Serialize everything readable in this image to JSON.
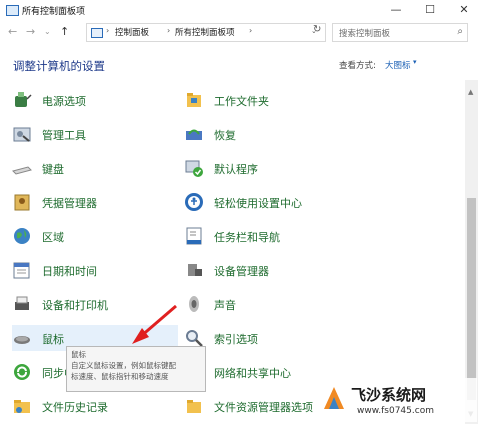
{
  "window": {
    "title": "所有控制面板项",
    "minimize": "—",
    "maximize": "☐",
    "close": "✕"
  },
  "address": {
    "crumbs": [
      "控制面板",
      "所有控制面板项"
    ],
    "refresh": "↻",
    "search_placeholder": "搜索控制面板"
  },
  "header": {
    "title": "调整计算机的设置",
    "view_by_label": "查看方式:",
    "view_by_value": "大图标",
    "caret": "▾"
  },
  "items_left": [
    {
      "label": "电源选项",
      "icon": "power-icon"
    },
    {
      "label": "管理工具",
      "icon": "admin-tools-icon"
    },
    {
      "label": "键盘",
      "icon": "keyboard-icon"
    },
    {
      "label": "凭据管理器",
      "icon": "credential-icon"
    },
    {
      "label": "区域",
      "icon": "globe-icon"
    },
    {
      "label": "日期和时间",
      "icon": "calendar-icon"
    },
    {
      "label": "设备和打印机",
      "icon": "printer-icon"
    },
    {
      "label": "鼠标",
      "icon": "mouse-icon"
    },
    {
      "label": "同步中心",
      "icon": "sync-icon"
    },
    {
      "label": "文件历史记录",
      "icon": "file-history-icon"
    }
  ],
  "items_right": [
    {
      "label": "工作文件夹",
      "icon": "work-folder-icon"
    },
    {
      "label": "恢复",
      "icon": "recovery-icon"
    },
    {
      "label": "默认程序",
      "icon": "default-programs-icon"
    },
    {
      "label": "轻松使用设置中心",
      "icon": "ease-of-access-icon"
    },
    {
      "label": "任务栏和导航",
      "icon": "taskbar-icon"
    },
    {
      "label": "设备管理器",
      "icon": "device-manager-icon"
    },
    {
      "label": "声音",
      "icon": "speaker-icon"
    },
    {
      "label": "索引选项",
      "icon": "index-icon"
    },
    {
      "label": "网络和共享中心",
      "icon": "network-icon"
    },
    {
      "label": "文件资源管理器选项",
      "icon": "explorer-options-icon"
    }
  ],
  "tooltip": {
    "title": "鼠标",
    "line1": "自定义鼠标设置，例如鼠标键配",
    "line2": "标速度、鼠标指针和移动速度"
  },
  "watermark": {
    "name": "飞沙系统网",
    "url": "www.fs0745.com"
  },
  "colors": {
    "link_green": "#1e6b2e",
    "heading_blue": "#1e3a8a",
    "accent_blue": "#1a5fb4",
    "arrow_red": "#e02020",
    "hover_bg": "#e5f0fb"
  }
}
